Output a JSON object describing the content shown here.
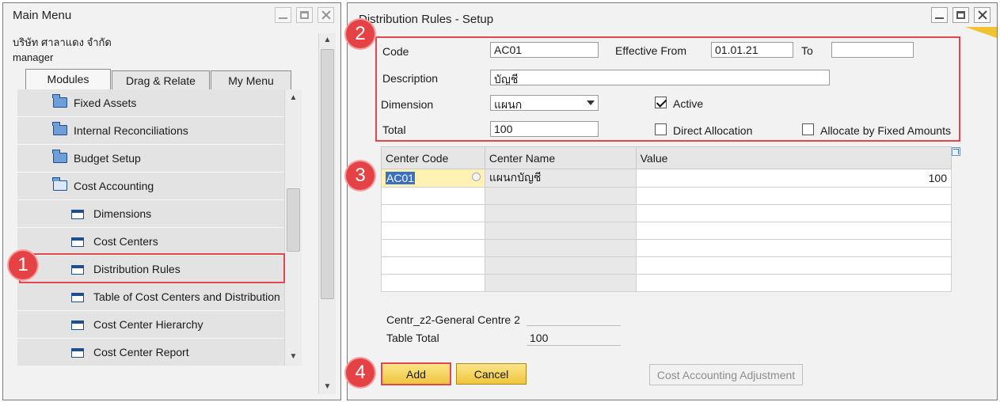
{
  "main_menu": {
    "title": "Main Menu",
    "company": "บริษัท ศาลาแดง จำกัด",
    "user": "manager",
    "tabs": [
      {
        "label": "Modules",
        "u": "o"
      },
      {
        "label": "Drag & Relate",
        "u": "r"
      },
      {
        "label": "My Menu",
        "u": "y"
      }
    ],
    "items": [
      {
        "label": "Fixed Assets",
        "icon": "folder-icon"
      },
      {
        "label": "Internal Reconciliations",
        "icon": "folder-icon"
      },
      {
        "label": "Budget Setup",
        "icon": "folder-icon"
      },
      {
        "label": "Cost Accounting",
        "icon": "open-folder-icon"
      },
      {
        "label": "Dimensions",
        "icon": "form-icon"
      },
      {
        "label": "Cost Centers",
        "icon": "form-icon"
      },
      {
        "label": "Distribution Rules",
        "icon": "form-icon"
      },
      {
        "label": "Table of Cost Centers and Distribution",
        "icon": "form-icon"
      },
      {
        "label": "Cost Center Hierarchy",
        "icon": "form-icon"
      },
      {
        "label": "Cost Center Report",
        "icon": "form-icon"
      }
    ]
  },
  "dist_rules": {
    "title": "Distribution Rules - Setup",
    "code_label": "Code",
    "code_value": "AC01",
    "effective_from_label": "Effective From",
    "effective_from_value": "01.01.21",
    "to_label": "To",
    "to_value": "",
    "description_label": "Description",
    "description_value": "บัญชี",
    "dimension_label": "Dimension",
    "dimension_value": "แผนก",
    "active_label": "Active",
    "active_checked": true,
    "total_label": "Total",
    "total_value": "100",
    "direct_allocation_label": "Direct Allocation",
    "direct_allocation_checked": false,
    "fixed_amounts_label": "Allocate by Fixed Amounts",
    "fixed_amounts_checked": false,
    "table": {
      "columns": [
        "Center Code",
        "Center Name",
        "Value"
      ],
      "rows": [
        {
          "code": "AC01",
          "name": "แผนกบัญชี",
          "value": "100"
        }
      ]
    },
    "centre_label": "Centr_z2-General Centre 2",
    "centre_value": "",
    "table_total_label": "Table Total",
    "table_total_value": "100",
    "buttons": {
      "add": "Add",
      "cancel": "Cancel",
      "adjustment": "Cost Accounting Adjustment"
    }
  },
  "annotations": [
    "1",
    "2",
    "3",
    "4"
  ],
  "colors": {
    "highlight_red": "#e0484b",
    "badge_red": "#e54246",
    "button_yellow": "#f0c53d",
    "selection_blue": "#3a6fc4"
  }
}
